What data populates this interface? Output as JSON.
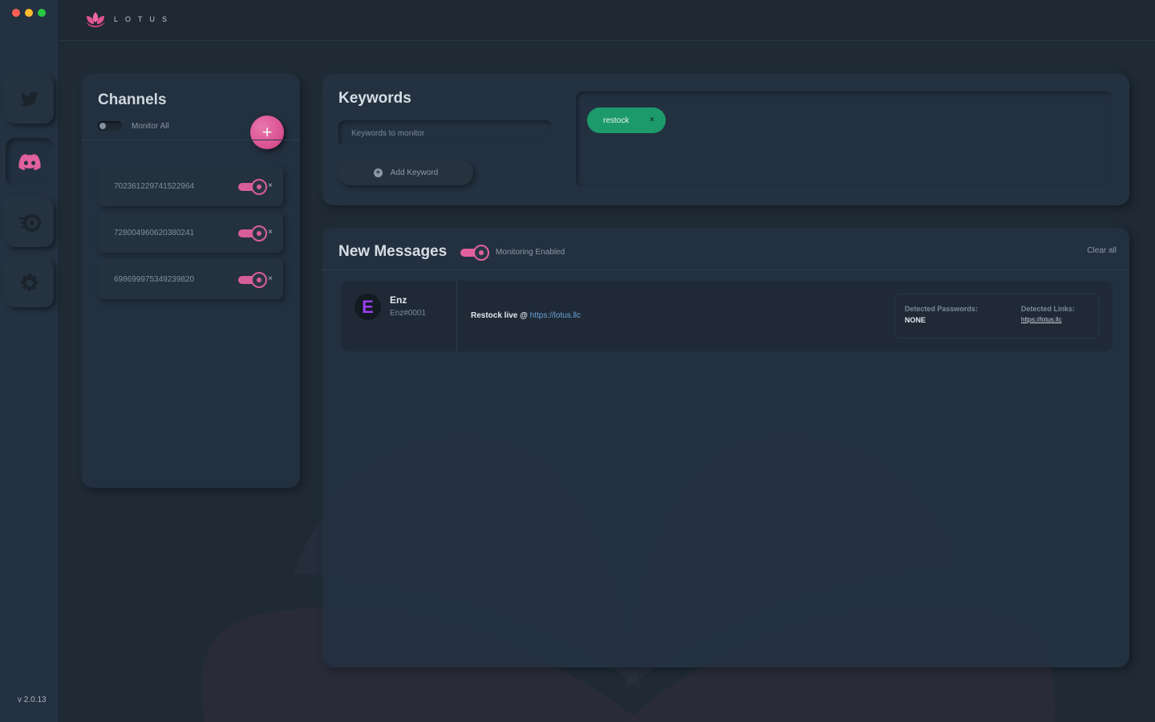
{
  "app": {
    "logo_text": "LOTUS",
    "version": "v 2.0.13"
  },
  "sidebar": {
    "items": [
      {
        "icon": "twitter-icon"
      },
      {
        "icon": "discord-icon",
        "active": true
      },
      {
        "icon": "speed-icon"
      },
      {
        "icon": "gear-icon"
      }
    ]
  },
  "channels": {
    "title": "Channels",
    "monitor_all_label": "Monitor All",
    "monitor_all_enabled": false,
    "add_label": "+",
    "items": [
      {
        "id": "702361229741522964",
        "enabled": true,
        "remove": "×"
      },
      {
        "id": "728004960620380241",
        "enabled": true,
        "remove": "×"
      },
      {
        "id": "698699975349239820",
        "enabled": true,
        "remove": "×"
      }
    ]
  },
  "keywords": {
    "title": "Keywords",
    "input_placeholder": "Keywords to monitor",
    "add_label": "Add Keyword",
    "add_icon": "+",
    "tags": [
      {
        "label": "restock",
        "remove": "×"
      }
    ]
  },
  "messages": {
    "title": "New Messages",
    "monitoring_label": "Monitoring Enabled",
    "monitoring_enabled": true,
    "clear_label": "Clear all",
    "items": [
      {
        "avatar_letter": "E",
        "name": "Enz",
        "tag": "Enz#0001",
        "text": "Restock live @ ",
        "link": "https://lotus.llc",
        "passwords_label": "Detected Passwords:",
        "passwords_value": "NONE",
        "links_label": "Detected Links:",
        "links_value": "https://lotus.llc"
      }
    ]
  },
  "colors": {
    "accent_pink": "#e0619e",
    "tag_green": "#1d9a6c",
    "background": "#1f2a35"
  }
}
